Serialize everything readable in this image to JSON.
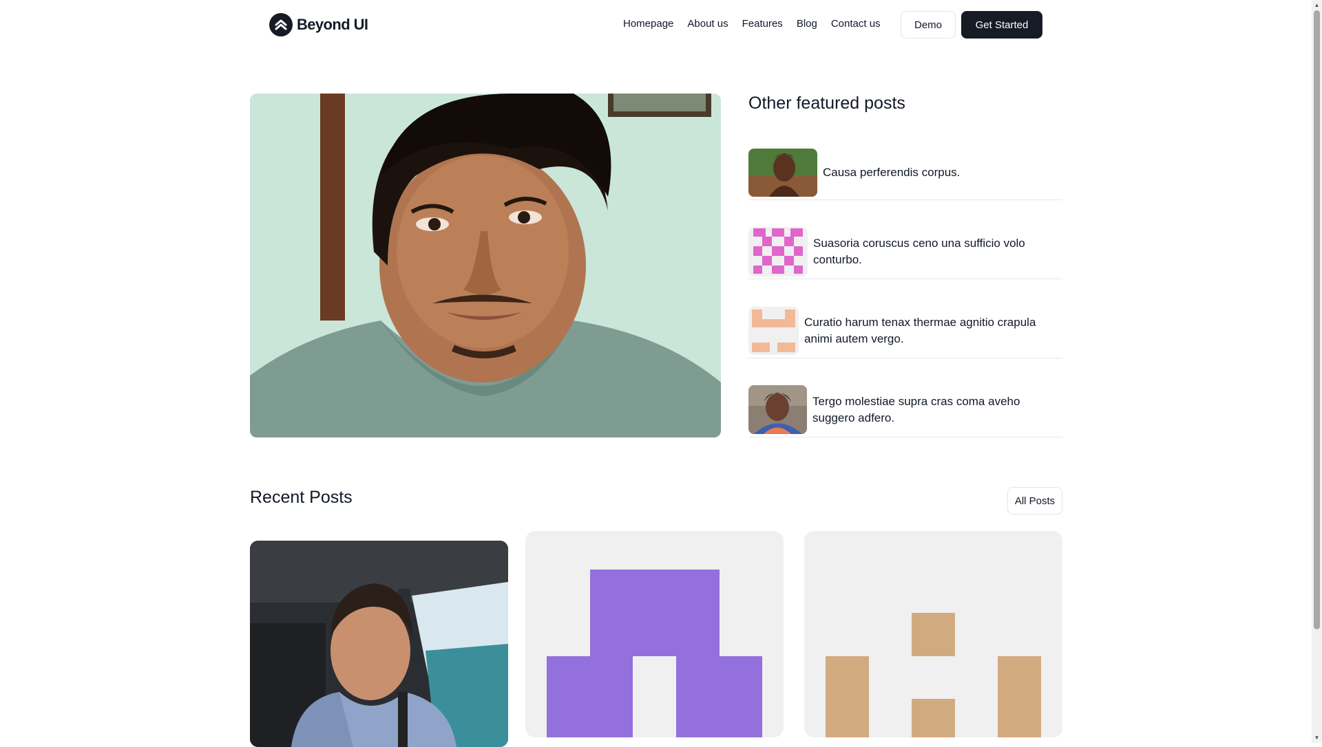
{
  "brand": {
    "name": "Beyond UI",
    "logo_icon": "chevrons-up-icon"
  },
  "nav": {
    "links": [
      "Homepage",
      "About us",
      "Features",
      "Blog",
      "Contact us"
    ],
    "demo_label": "Demo",
    "cta_label": "Get Started",
    "cta_color": "#161b26"
  },
  "hero": {
    "image": "portrait-photo-young-man"
  },
  "featured": {
    "heading": "Other featured posts",
    "items": [
      {
        "title": "Causa perferendis corpus.",
        "thumb": "portrait-photo-woman"
      },
      {
        "title": "Suasoria coruscus ceno una sufficio volo conturbo.",
        "thumb": "pink-identicon"
      },
      {
        "title": "Curatio harum tenax thermae agnitio crapula animi autem vergo.",
        "thumb": "peach-identicon"
      },
      {
        "title": "Tergo molestiae supra cras coma aveho suggero adfero.",
        "thumb": "portrait-photo-elderly-woman"
      }
    ]
  },
  "recent": {
    "heading": "Recent Posts",
    "all_label": "All Posts",
    "cards": [
      {
        "image": "selfie-photo-man-in-car"
      },
      {
        "image": "purple-identicon",
        "color": "#9370db"
      },
      {
        "image": "tan-identicon",
        "color": "#d2aa80"
      }
    ]
  }
}
